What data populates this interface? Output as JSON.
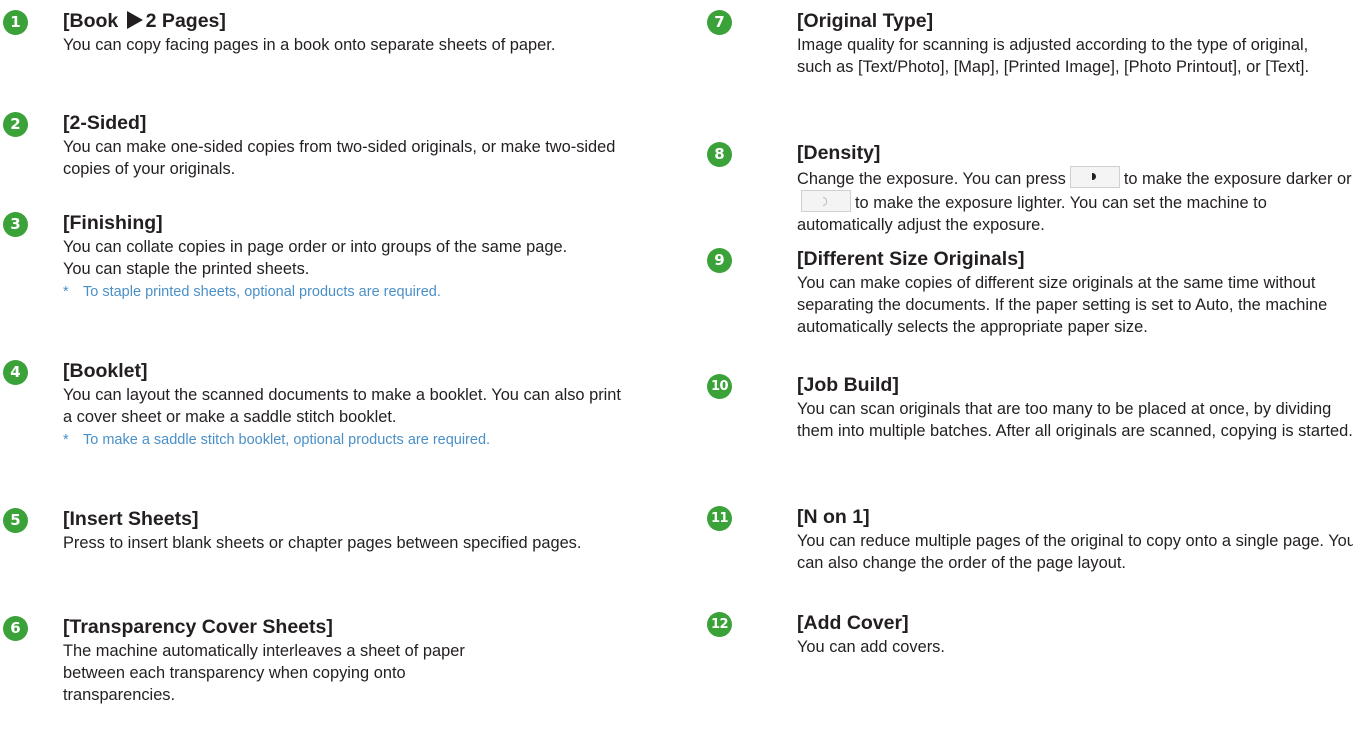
{
  "left": [
    {
      "num": "1",
      "title_pre": "[Book ",
      "title_post": "2 Pages]",
      "desc": "You can copy facing pages in a book onto separate sheets of paper."
    },
    {
      "num": "2",
      "title": "[2-Sided]",
      "desc": "You can make one-sided copies from two-sided originals, or make two-sided copies of your originals."
    },
    {
      "num": "3",
      "title": "[Finishing]",
      "desc": "You can collate copies in page order or into groups of the same page.",
      "desc2": "You can staple the printed sheets.",
      "note_mark": "*",
      "note": "To staple printed sheets, optional products are required."
    },
    {
      "num": "4",
      "title": "[Booklet]",
      "desc": "You can layout the scanned documents to make a booklet. You can also print a cover sheet or make a saddle stitch booklet.",
      "note_mark": "*",
      "note": "To make a saddle stitch booklet, optional products are required."
    },
    {
      "num": "5",
      "title": "[Insert Sheets]",
      "desc": "Press to insert blank sheets or chapter pages between specified pages."
    },
    {
      "num": "6",
      "title": "[Transparency Cover Sheets]",
      "desc": "The machine automatically interleaves a sheet of paper between each transparency when copying onto transparencies."
    }
  ],
  "right": [
    {
      "num": "7",
      "title": "[Original Type]",
      "desc": "Image quality for scanning is adjusted according to the type of original, such as [Text/Photo], [Map], [Printed Image], [Photo Printout], or [Text]."
    },
    {
      "num": "8",
      "title": "[Density]",
      "desc_a": "Change the exposure. You can press",
      "desc_b": "to make the exposure darker or",
      "desc_c": "to make the exposure lighter. You can set the machine to automatically adjust the exposure."
    },
    {
      "num": "9",
      "title": "[Different Size Originals]",
      "desc": "You can make copies of different size originals at the same time without separating the documents. If the paper setting is set to Auto, the machine automatically selects the appropriate paper size."
    },
    {
      "num": "10",
      "title": "[Job Build]",
      "desc": "You can scan originals that are too many to be placed at once, by dividing them into multiple batches. After all originals are scanned, copying is started."
    },
    {
      "num": "11",
      "title": "[N on 1]",
      "desc": "You can reduce multiple pages of the original to copy onto a single page. You can also change the order of the page layout."
    },
    {
      "num": "12",
      "title": "[Add Cover]",
      "desc": "You can add covers."
    }
  ]
}
